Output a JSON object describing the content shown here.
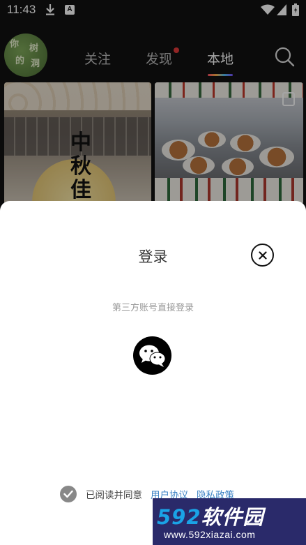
{
  "status_bar": {
    "time": "11:43",
    "icons": [
      "download-icon",
      "a-badge-icon",
      "wifi-icon",
      "signal-icon",
      "battery-icon"
    ],
    "a_badge": "A"
  },
  "header": {
    "avatar_text": [
      "你",
      "的",
      "树",
      "洞"
    ],
    "tabs": [
      {
        "label": "关注",
        "active": false
      },
      {
        "label": "发现",
        "active": false,
        "has_dot": true
      },
      {
        "label": "本地",
        "active": true
      }
    ],
    "search_icon": "search-icon"
  },
  "feed": {
    "left_card_calligraphy": "中秋佳",
    "right_card_icon": "copy-icon"
  },
  "login_sheet": {
    "title": "登录",
    "close_icon": "close-icon",
    "subtitle": "第三方账号直接登录",
    "wechat_icon": "wechat-icon",
    "agree_text": "已阅读并同意",
    "user_agreement": "用户协议",
    "privacy_policy": "隐私政策",
    "checked": true
  },
  "watermark": {
    "brand_num": "592",
    "brand_cn": "软件园",
    "url": "www.592xiazai.com"
  },
  "colors": {
    "link": "#3b82c4",
    "tab_dot": "#e03a3a",
    "sheet_bg": "#ffffff",
    "watermark_accent": "#1aa3e6"
  }
}
